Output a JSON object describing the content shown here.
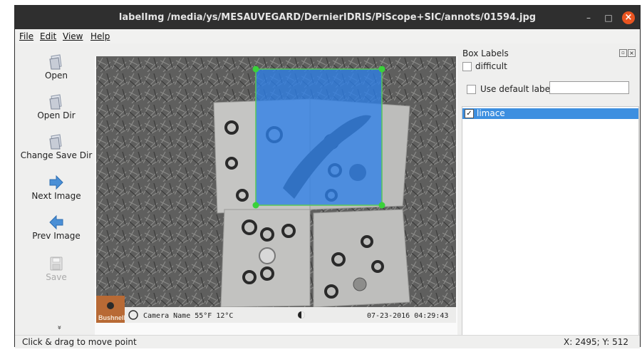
{
  "window": {
    "title": "labelImg /media/ys/MESAUVEGARD/DernierIDRIS/PiScope+SIC/annots/01594.jpg",
    "controls": {
      "minimize": "–",
      "maximize": "□",
      "close": "×"
    }
  },
  "menu": {
    "file": "File",
    "edit": "Edit",
    "view": "View",
    "help": "Help"
  },
  "toolbar": {
    "open": "Open",
    "open_dir": "Open Dir",
    "change_save_dir": "Change Save Dir",
    "next_image": "Next Image",
    "prev_image": "Prev Image",
    "save": "Save",
    "more": "»"
  },
  "image": {
    "camera_info": "Camera Name  55°F 12°C",
    "timestamp": "07-23-2016 04:29:43",
    "brand": "Bushnell",
    "box_label": "limace"
  },
  "panel": {
    "title": "Box Labels",
    "difficult_label": "difficult",
    "difficult_checked": false,
    "use_default_label": "Use default label",
    "use_default_checked": false,
    "default_label_value": "",
    "labels": [
      {
        "name": "limace",
        "checked": true,
        "selected": true
      }
    ]
  },
  "status": {
    "message": "Click & drag to move point",
    "coords": "X: 2495; Y: 512"
  },
  "colors": {
    "selection": "#3d8fe0",
    "box_fill": "#2d7fe8",
    "handle": "#3ad13a",
    "close_button": "#e95420"
  }
}
